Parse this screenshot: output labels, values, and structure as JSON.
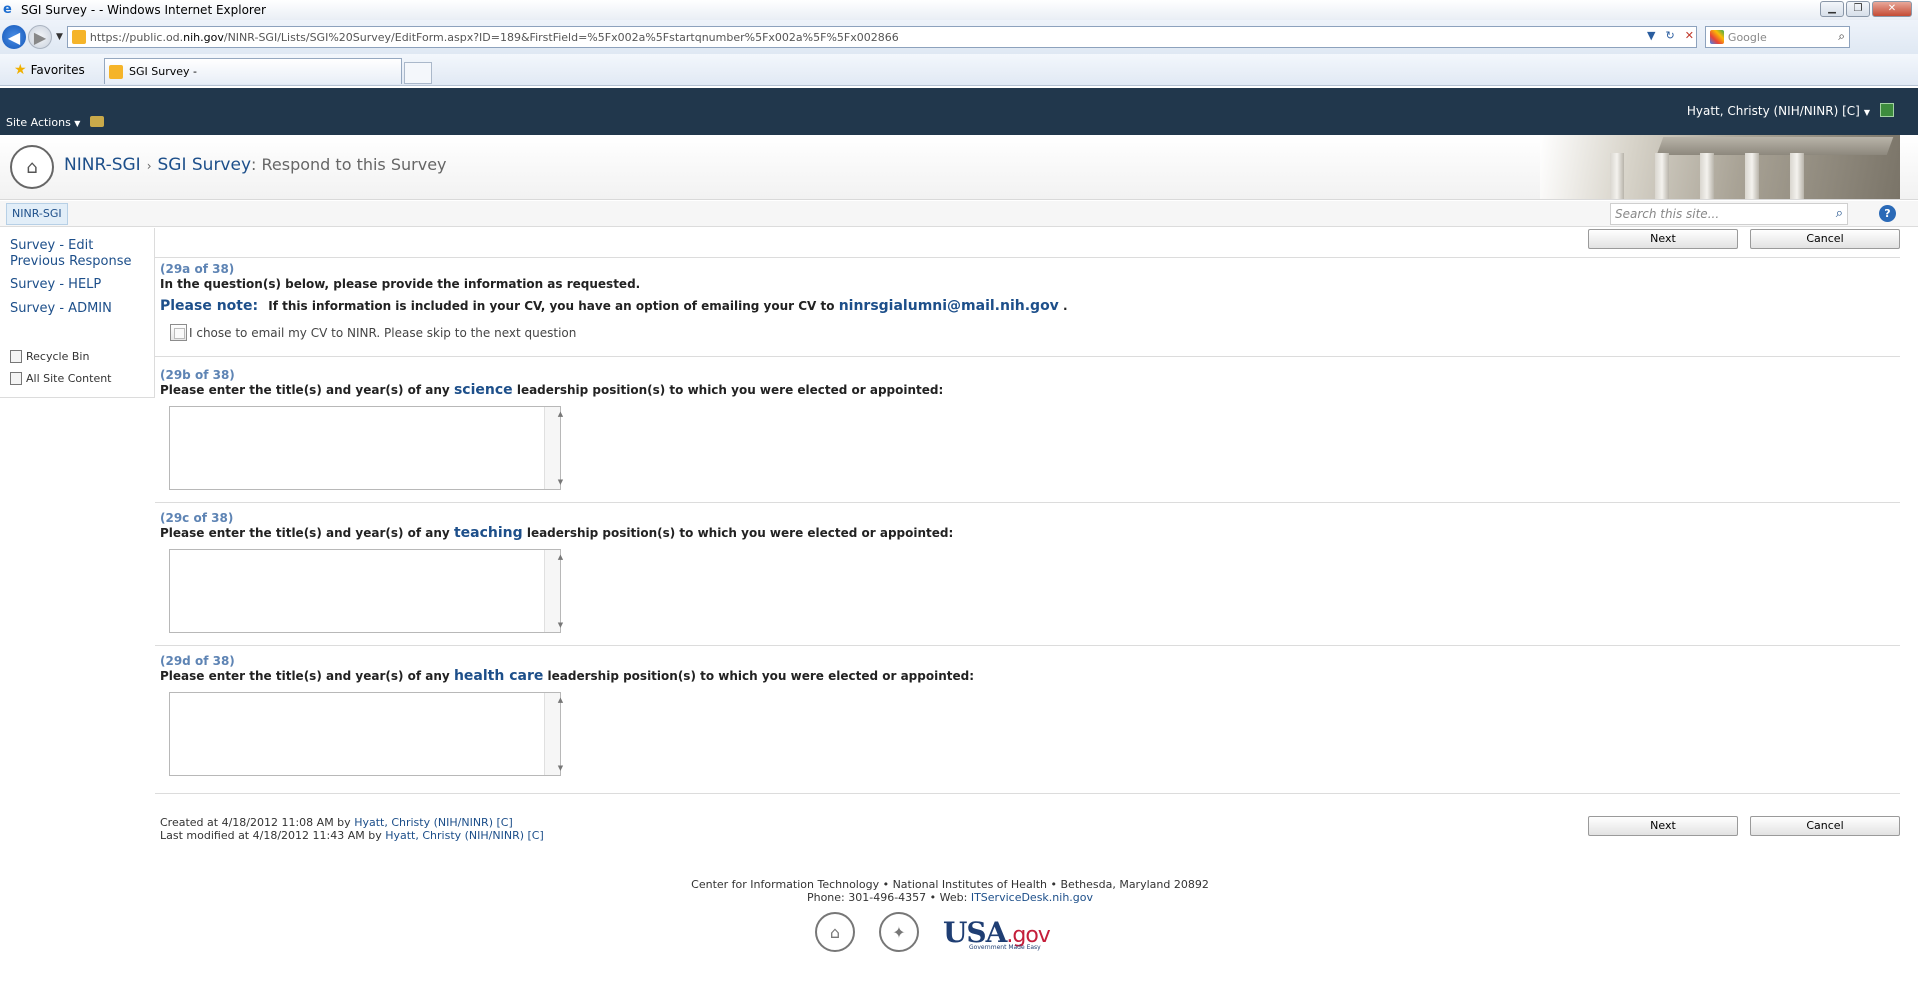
{
  "window": {
    "title": "SGI Survey - - Windows Internet Explorer"
  },
  "browser": {
    "url_prefix": "https://public.od.",
    "url_host": "nih.gov",
    "url_path": "/NINR-SGI/Lists/SGI%20Survey/EditForm.aspx?ID=189&FirstField=%5Fx002a%5Fstartqnumber%5Fx002a%5F%5Fx002866",
    "search_placeholder": "Google",
    "favorites_label": "Favorites",
    "tab_label": "SGI Survey -"
  },
  "ribbon": {
    "site_actions": "Site Actions",
    "user": "Hyatt, Christy (NIH/NINR) [C]"
  },
  "site": {
    "crumb_root": "NINR-SGI",
    "crumb_list": "SGI Survey",
    "page_title": ": Respond to this Survey",
    "home_tab": "NINR-SGI",
    "search_placeholder": "Search this site..."
  },
  "leftnav": {
    "items": [
      {
        "label": "Survey - Edit Previous Response"
      },
      {
        "label": "Survey - HELP"
      },
      {
        "label": "Survey - ADMIN"
      }
    ],
    "recycle_bin": "Recycle Bin",
    "all_site_content": "All Site Content"
  },
  "buttons": {
    "next": "Next",
    "cancel": "Cancel"
  },
  "questions": {
    "q29a": {
      "num": "(29a of 38)",
      "text": "In the question(s) below, please provide the information as requested.",
      "note_label": "Please note:",
      "note_text": "If this information is included in your CV, you have an option of emailing your CV to",
      "note_email": "ninrsgialumni@mail.nih.gov",
      "note_end": ".",
      "checkbox_label": "I chose to email my CV to NINR. Please skip to the next question"
    },
    "q29b": {
      "num": "(29b of 38)",
      "pre": "Please enter the title(s) and year(s) of any",
      "em": "science",
      "post": "leadership position(s) to which you were elected or appointed:"
    },
    "q29c": {
      "num": "(29c of 38)",
      "pre": "Please enter the title(s) and year(s) of any",
      "em": "teaching",
      "post": "leadership position(s) to which you were elected or appointed:"
    },
    "q29d": {
      "num": "(29d of 38)",
      "pre": "Please enter the title(s) and year(s) of any",
      "em": "health care",
      "post": "leadership position(s) to which you were elected or appointed:"
    }
  },
  "meta": {
    "created_prefix": "Created at 4/18/2012 11:08 AM by",
    "created_by": "Hyatt, Christy (NIH/NINR) [C]",
    "modified_prefix": "Last modified at 4/18/2012 11:43 AM by",
    "modified_by": "Hyatt, Christy (NIH/NINR) [C]"
  },
  "footer": {
    "line1": "Center for Information Technology • National Institutes of Health • Bethesda, Maryland 20892",
    "line2_prefix": "Phone: 301-496-4357 • Web:",
    "line2_link": "ITServiceDesk.nih.gov",
    "usagov_main": "USA",
    "usagov_dot": ".gov",
    "usagov_tag": "Government Made Easy"
  }
}
